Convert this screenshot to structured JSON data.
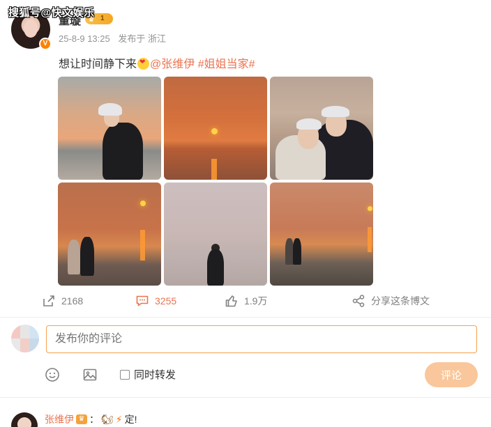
{
  "watermark": "搜狐号@快文娱乐",
  "post": {
    "username": "董璇",
    "level": "1",
    "date": "25-8-9 13:25",
    "source": "发布于 浙江",
    "text_main": "想让时间静下来",
    "mention": "@张维伊",
    "hashtag": "#姐姐当家#"
  },
  "stats": {
    "reposts": "2168",
    "comments": "3255",
    "likes": "1.9万",
    "share_label": "分享这条博文"
  },
  "composer": {
    "placeholder": "发布你的评论",
    "forward_label": "同时转发",
    "submit_label": "评论"
  },
  "reply": {
    "name": "张维伊",
    "separator": "：",
    "text": "定!"
  },
  "colors": {
    "accent": "#eb7350",
    "orange": "#ff8200",
    "submit_bg": "#f9c79b",
    "input_border": "#f7a24c"
  }
}
